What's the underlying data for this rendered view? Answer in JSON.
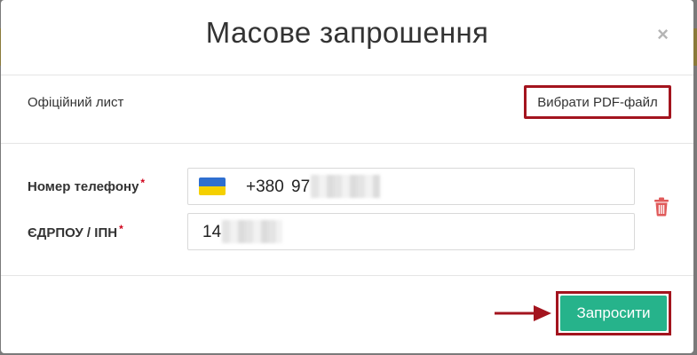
{
  "modal": {
    "title": "Масове запрошення",
    "close_icon": "close-icon"
  },
  "letter": {
    "label": "Офіційний лист",
    "button_label": "Вибрати PDF-файл"
  },
  "form": {
    "phone": {
      "label": "Номер телефону",
      "required_mark": "*",
      "country_flag": "ukraine-flag-icon",
      "country_code": "+380",
      "value_visible": "97"
    },
    "edrpou": {
      "label": "ЄДРПОУ / ІПН",
      "required_mark": "*",
      "value_visible": "14"
    },
    "delete_icon": "trash-icon"
  },
  "footer": {
    "submit_label": "Запросити"
  },
  "colors": {
    "accent": "#26b38b",
    "highlight": "#a3141e",
    "delete": "#e05a5a",
    "flag_blue": "#2f6fd0",
    "flag_yellow": "#f5d000"
  }
}
